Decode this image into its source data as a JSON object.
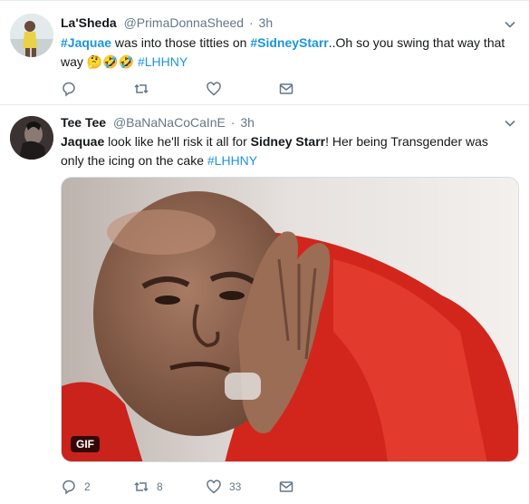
{
  "tweets": [
    {
      "name": "La'Sheda",
      "handle": "@PrimaDonnaSheed",
      "dot": "·",
      "time": "3h",
      "text": {
        "tag1": "#Jaquae",
        "t1": " was into those titties on ",
        "tag2": "#SidneyStarr",
        "t2": "..Oh so you swing that way that way ",
        "emoji": "🤔🤣🤣 ",
        "tag3": "#LHHNY"
      },
      "actions": {
        "reply": "",
        "retweet": "",
        "like": ""
      }
    },
    {
      "name": "Tee Tee",
      "handle": "@BaNaNaCoCaInE",
      "dot": "·",
      "time": "3h",
      "text": {
        "m1": "Jaquae",
        "t1": " look like he'll risk it all for ",
        "m2": "Sidney Starr",
        "t2": "! Her being Transgender was only the icing on the cake ",
        "tag": "#LHHNY"
      },
      "media_badge": "GIF",
      "actions": {
        "reply": "2",
        "retweet": "8",
        "like": "33"
      }
    }
  ],
  "colors": {
    "link": "#1b95e0",
    "muted": "#657786",
    "text": "#14171a",
    "gif_bg_red": "#d8281f"
  },
  "icons": [
    "chevron-down-icon",
    "reply-icon",
    "retweet-icon",
    "like-icon",
    "message-icon"
  ]
}
